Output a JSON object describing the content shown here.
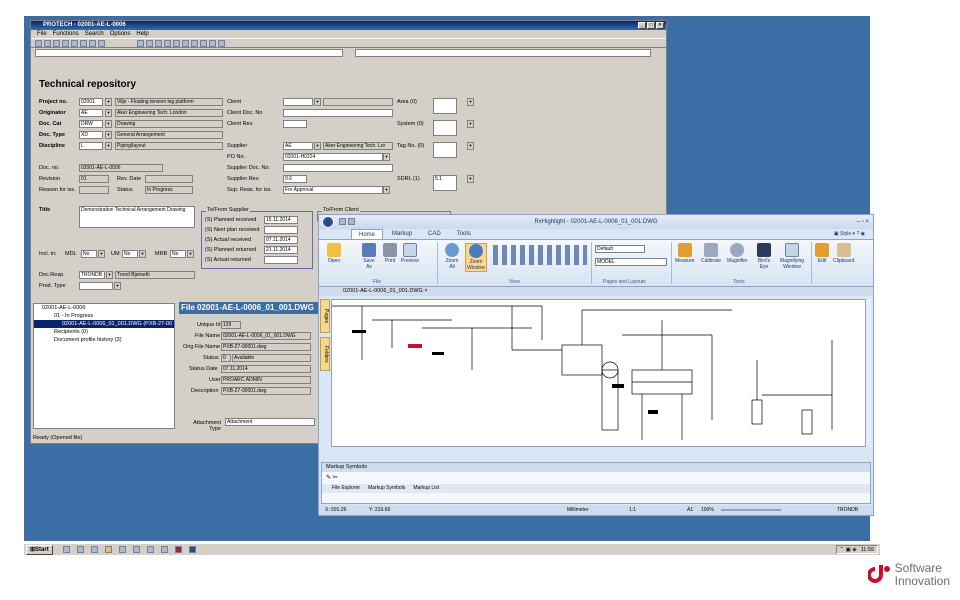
{
  "colors": {
    "desktop": "#3a6ea5",
    "accent": "#c8102e"
  },
  "protech": {
    "title": "PROTECH - 02001-AE-L-0006",
    "menu": [
      "File",
      "Functions",
      "Search",
      "Options",
      "Help"
    ],
    "heading": "Technical repository",
    "project_no_label": "Project no.",
    "project_no": "02001",
    "project_name": "Vilje - Floating tension leg platform",
    "originator_label": "Originator",
    "originator": "AE",
    "originator_name": "Aker Engineering Tech. London",
    "doc_cat_label": "Doc. Cat",
    "doc_cat": "DRW",
    "doc_cat_name": "Drawing",
    "doc_type_label": "Doc. Type",
    "doc_type": "XD",
    "doc_type_name": "General Arrangement",
    "discipline_label": "Discipline",
    "discipline": "L",
    "discipline_name": "Piping/layout",
    "doc_no_label": "Doc. no.",
    "doc_no": "02001-AE-L-0006",
    "revision_label": "Revision",
    "revision": "01",
    "rev_date_label": "Rev. Date",
    "reason_label": "Reason for iss.",
    "status_label": "Status",
    "status": "In Progress",
    "client_label": "Client",
    "client_doc_label": "Client Doc. No",
    "client_rev_label": "Client Rev.",
    "area_label": "Area (0)",
    "system_label": "System (0)",
    "tag_label": "Tag No. (0)",
    "supplier_label": "Supplier",
    "supplier": "AE",
    "supplier_name": "Aker Engineering Tech. Lor",
    "po_label": "PO No.",
    "po": "02001-H0224",
    "supplier_doc_label": "Supplier Doc. No.",
    "supplier_rev_label": "Supplier Rev.",
    "supplier_rev": "0.6",
    "sup_reas_label": "Sup. Reas. for iss.",
    "sup_reas": "For Approval",
    "sdrl_label": "SDRL (1)",
    "sdrl": "5.1",
    "title_label": "Title",
    "title_value": "Demonstration Technical Arrangement Drawing",
    "to_from_supplier": "To/From Supplier",
    "to_from_client": "To/From Client",
    "planned_received_label": "(S) Planned received",
    "planned_received": "15.11.2014",
    "next_plan_label": "(S) Next plan received",
    "actual_received_label": "(S) Actual received",
    "actual_received": "07.11.2014",
    "planned_returned_label": "(S) Planned returned",
    "planned_returned": "21.11.2014",
    "actual_returned_label": "(S) Actual returned",
    "incl_label": "Incl. in:",
    "mdl_label": "MDL",
    "mdl": "No",
    "um_label": "UM",
    "um": "No",
    "mrb_label": "MRB",
    "mrb": "No",
    "doc_resp_label": "Doc.Resp.",
    "doc_resp": "TRONDB",
    "doc_resp_name": "Trond Bjørseth",
    "prod_type_label": "Prod. Type",
    "tree": [
      "02001-AE-L-0006",
      "01 - In Progress",
      "02001-AE-L-0006_01_001.DWG (PXB-27-00",
      "Recipients (0)",
      "Document profile history (3)"
    ],
    "file_heading": "File 02001-AE-L-0006_01_001.DWG",
    "unique_id_label": "Unique Id",
    "unique_id": "129",
    "file_name_label": "File Name",
    "file_name": "02001-AE-L-0006_01_001.DWG",
    "orig_file_label": "Orig File Name",
    "orig_file": "PXB-27-00001.dwg",
    "file_status_label": "Status",
    "file_status_code": "0",
    "file_status": "Available",
    "status_date_label": "Status Date",
    "status_date": "07.11.2014",
    "user_label": "User",
    "user": "PROARC.ADMIN",
    "description_label": "Description",
    "description": "PXB-27-00001.dwg",
    "attachment_label": "Attachment Type",
    "attachment": "Attachment",
    "status_bar": "Ready (Opened file)"
  },
  "rx": {
    "title": "RxHighlight - 02001-AE-L-0006_01_001.DWG",
    "tabs": [
      "Home",
      "Markup",
      "CAD",
      "Tools"
    ],
    "style_label": "Style",
    "buttons": {
      "open": "Open",
      "save": "Save As",
      "print": "Print",
      "preview": "Preview",
      "zoom_all": "Zoom All",
      "zoom_window": "Zoom Window",
      "measure": "Measure",
      "calibrate": "Calibrate",
      "magnifier": "Magnifier",
      "birds_eye": "Bird's Eye",
      "magnifying_window": "Magnifying Window",
      "edit": "Edit",
      "clipboard": "Clipboard"
    },
    "groups": {
      "file": "File",
      "view": "View",
      "pages": "Pages and Layouts",
      "tools": "Tools"
    },
    "layout_value": "Default",
    "model_value": "MODEL",
    "doc_tab": "02001-AE-L-0006_01_001.DWG",
    "side_pages": "Pages",
    "side_folders": "Folders",
    "markup_symbols": "Markup Symbols",
    "bottom_tabs": [
      "File Explorer",
      "Markup Symbols",
      "Markup List"
    ],
    "x_coord": "X: 591.26",
    "y_coord": "Y: 219.69",
    "units": "Millimeter",
    "scale": "1:1",
    "layer": "A1",
    "zoom": "100%",
    "user": "TRONDB"
  },
  "taskbar": {
    "start": "Start",
    "clock": "11:59"
  },
  "logo": {
    "line1": "Software",
    "line2": "Innovation"
  }
}
